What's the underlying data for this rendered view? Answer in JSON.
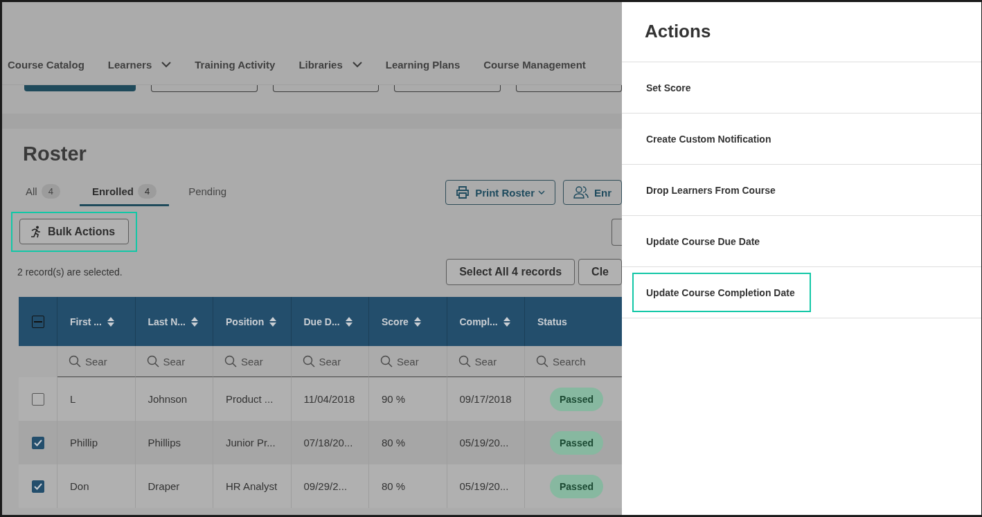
{
  "nav": [
    {
      "label": "Course Catalog",
      "dropdown": false
    },
    {
      "label": "Learners",
      "dropdown": true
    },
    {
      "label": "Training Activity",
      "dropdown": false
    },
    {
      "label": "Libraries",
      "dropdown": true
    },
    {
      "label": "Learning Plans",
      "dropdown": false
    },
    {
      "label": "Course Management",
      "dropdown": false
    }
  ],
  "hidden_buttons": [
    {
      "kind": "filled"
    },
    {
      "kind": "outline"
    },
    {
      "kind": "outline"
    },
    {
      "kind": "outline"
    },
    {
      "kind": "outline"
    }
  ],
  "roster": {
    "title": "Roster",
    "tabs": [
      {
        "label": "All",
        "count": "4",
        "selected": false
      },
      {
        "label": "Enrolled",
        "count": "4",
        "selected": true
      },
      {
        "label": "Pending",
        "selected": false
      }
    ],
    "toolbar": [
      {
        "label": "Print Roster",
        "kind": "print",
        "dropdown": true
      },
      {
        "label": "Enr",
        "kind": "people",
        "dropdown": false
      }
    ],
    "bulk_actions": {
      "label": "Bulk Actions",
      "highlighted": true
    },
    "selection_text": "2 record(s) are selected.",
    "select_all_button": "Select All 4 records",
    "clear_button": "Cle",
    "table": {
      "select_all_partial": true,
      "columns": [
        {
          "label": "First ...",
          "sortable": true,
          "placeholder": "Sear"
        },
        {
          "label": "Last N...",
          "sortable": true,
          "placeholder": "Sear"
        },
        {
          "label": "Position",
          "sortable": true,
          "placeholder": "Sear"
        },
        {
          "label": "Due D...",
          "sortable": true,
          "placeholder": "Sear"
        },
        {
          "label": "Score",
          "sortable": true,
          "placeholder": "Sear"
        },
        {
          "label": "Compl...",
          "sortable": true,
          "placeholder": "Sear"
        },
        {
          "label": "Status",
          "sortable": false,
          "placeholder": "Search"
        }
      ],
      "rows": [
        {
          "selected": false,
          "cells": [
            "L",
            "Johnson",
            "Product ...",
            "11/04/2018",
            "90 %",
            "09/17/2018"
          ],
          "status": "Passed"
        },
        {
          "selected": true,
          "cells": [
            "Phillip",
            "Phillips",
            "Junior Pr...",
            "07/18/20...",
            "80 %",
            "05/19/20..."
          ],
          "status": "Passed"
        },
        {
          "selected": true,
          "cells": [
            "Don",
            "Draper",
            "HR Analyst",
            "09/29/2...",
            "80 %",
            "05/19/20..."
          ],
          "status": "Passed"
        }
      ]
    }
  },
  "panel": {
    "title": "Actions",
    "items": [
      {
        "label": "Set Score",
        "highlighted": false
      },
      {
        "label": "Create Custom Notification",
        "highlighted": false
      },
      {
        "label": "Drop Learners From Course",
        "highlighted": false
      },
      {
        "label": "Update Course Due Date",
        "highlighted": false
      },
      {
        "label": "Update Course Completion Date",
        "highlighted": true
      }
    ]
  }
}
